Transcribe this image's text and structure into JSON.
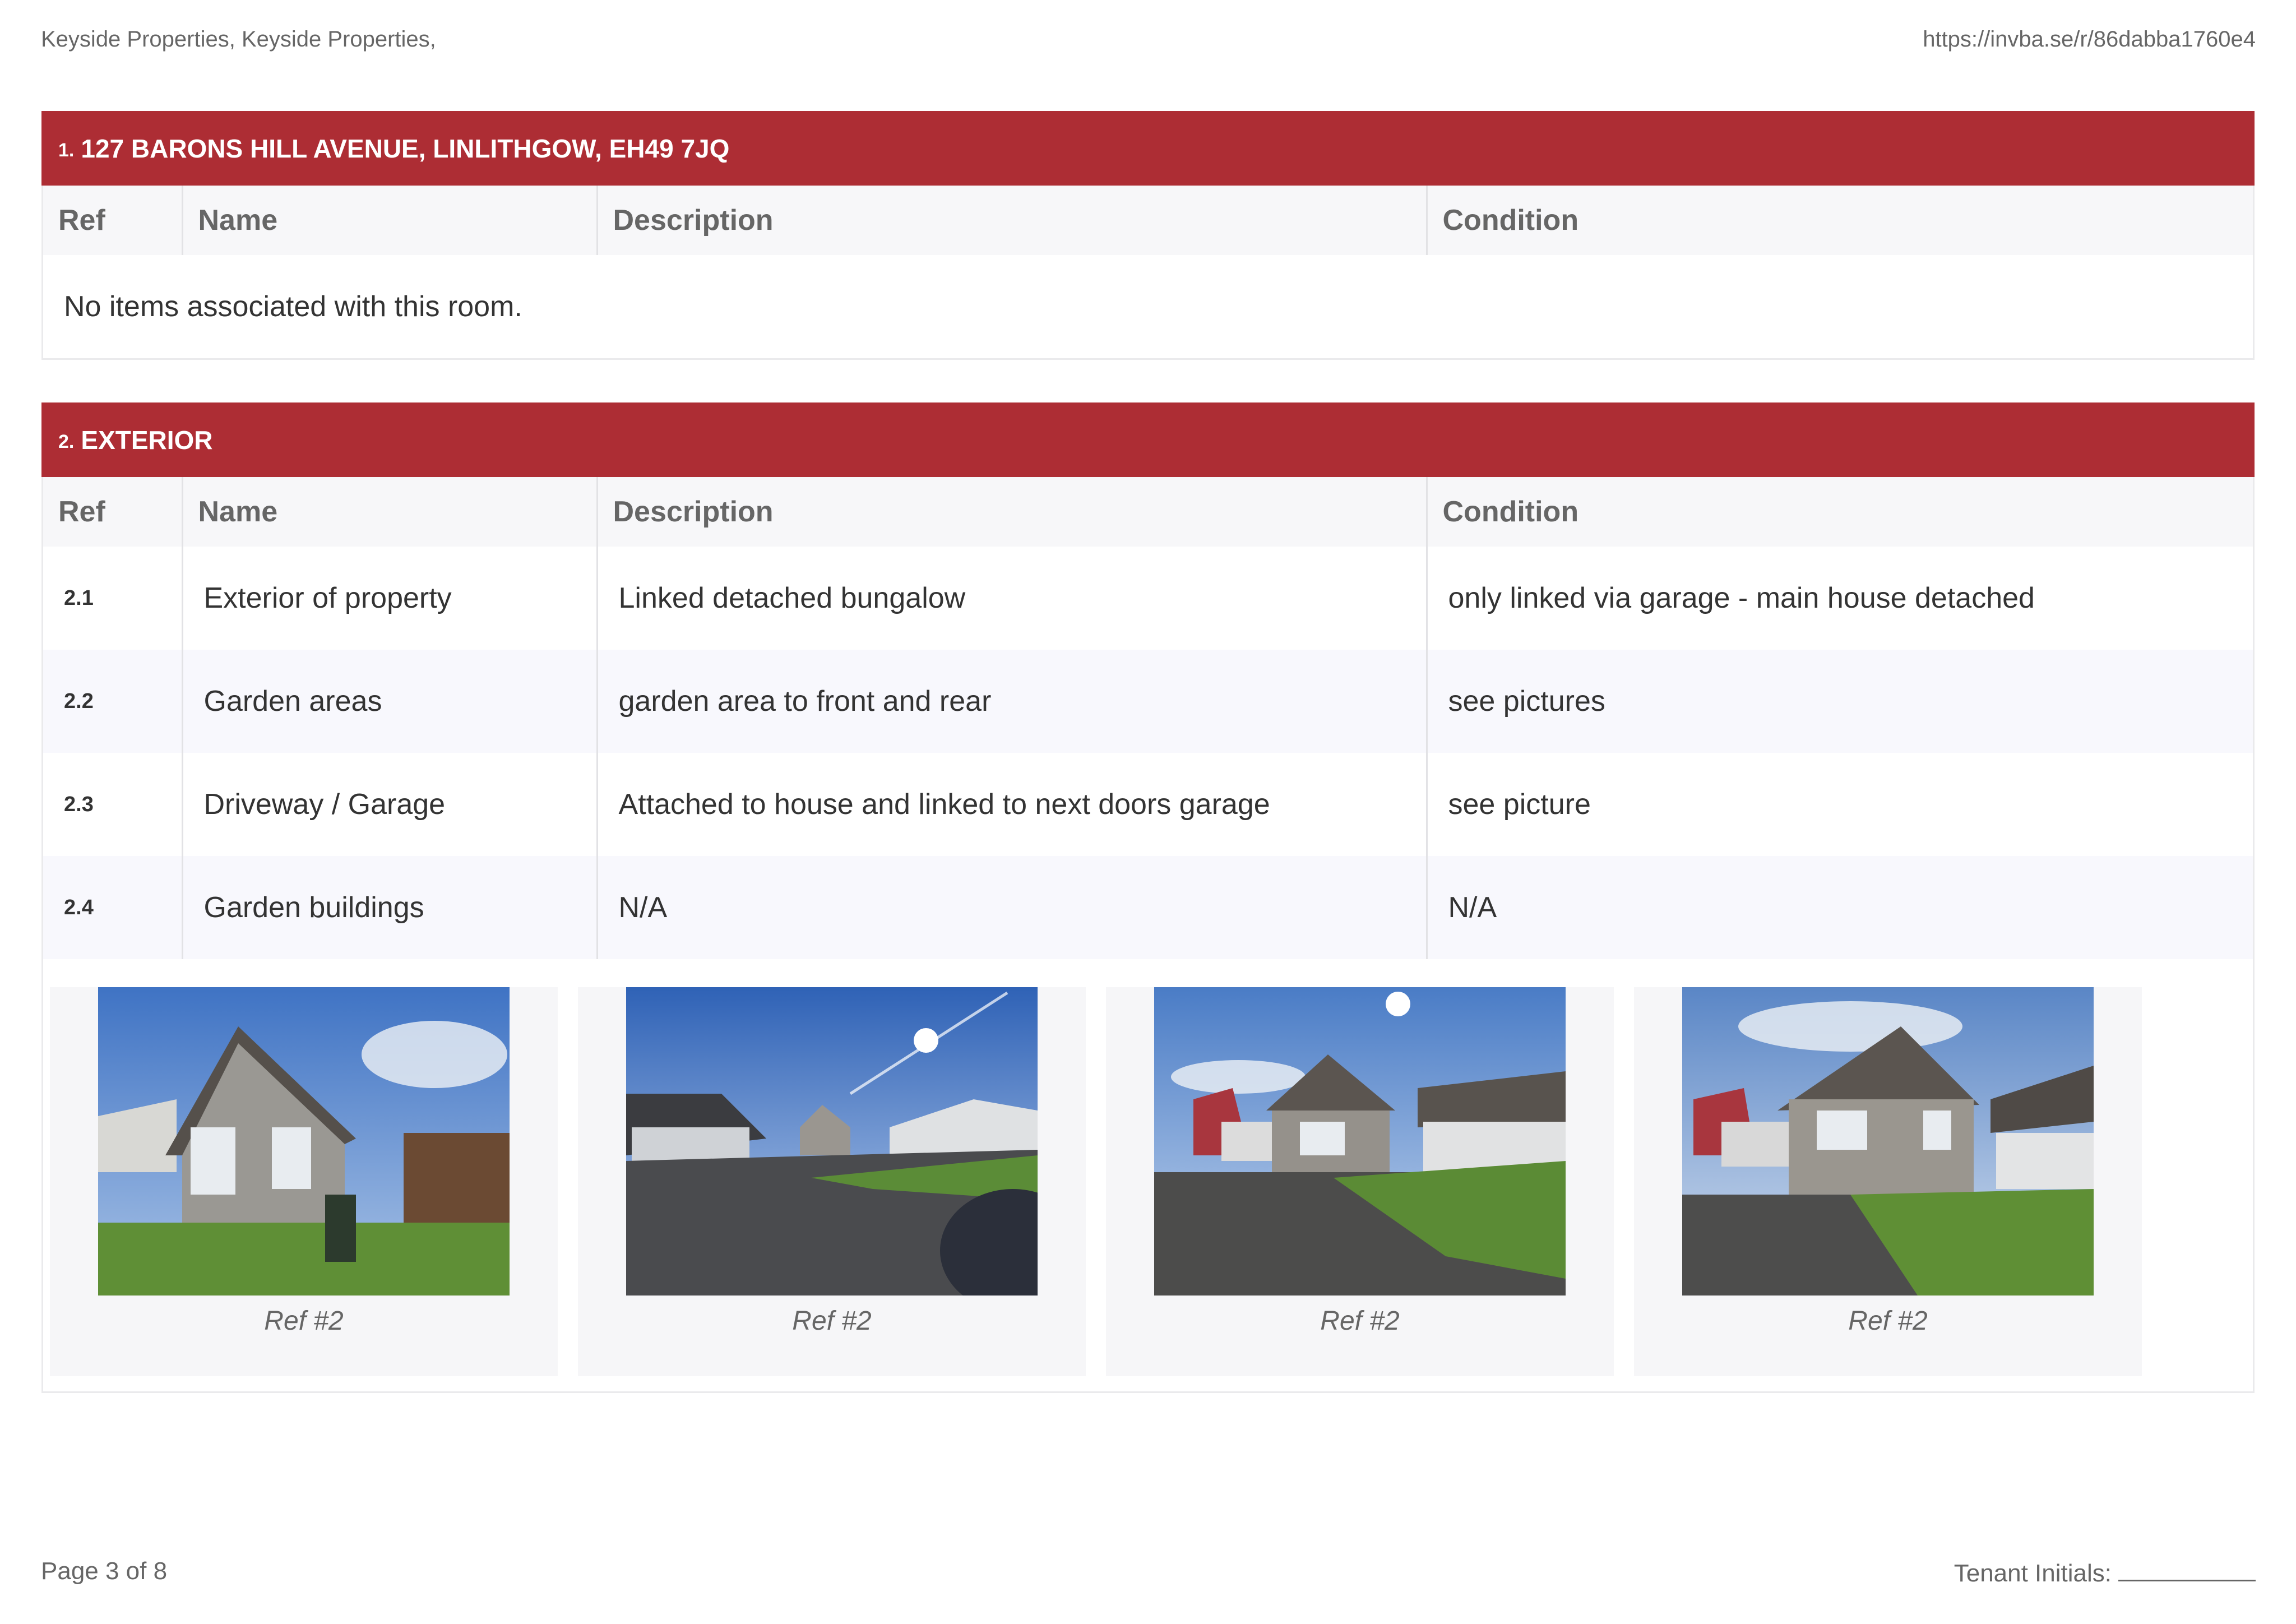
{
  "header": {
    "company": "Keyside Properties, Keyside Properties,",
    "url": "https://invba.se/r/86dabba1760e4"
  },
  "columns": [
    "Ref",
    "Name",
    "Description",
    "Condition"
  ],
  "sections": [
    {
      "number": "1.",
      "title": "127 BARONS HILL AVENUE, LINLITHGOW, EH49 7JQ",
      "empty_message": "No items associated with this room."
    },
    {
      "number": "2.",
      "title": "EXTERIOR",
      "rows": [
        {
          "ref": "2.1",
          "name": "Exterior of property",
          "description": "Linked detached bungalow",
          "condition": "only linked via garage - main house detached"
        },
        {
          "ref": "2.2",
          "name": "Garden areas",
          "description": "garden area to front and rear",
          "condition": "see pictures"
        },
        {
          "ref": "2.3",
          "name": "Driveway / Garage",
          "description": "Attached to house and linked to next doors garage",
          "condition": "see picture"
        },
        {
          "ref": "2.4",
          "name": "Garden buildings",
          "description": "N/A",
          "condition": "N/A"
        }
      ],
      "photos": [
        {
          "caption": "Ref #2"
        },
        {
          "caption": "Ref #2"
        },
        {
          "caption": "Ref #2"
        },
        {
          "caption": "Ref #2"
        }
      ]
    }
  ],
  "footer": {
    "page": "Page 3 of 8",
    "initials_label": "Tenant Initials:"
  }
}
